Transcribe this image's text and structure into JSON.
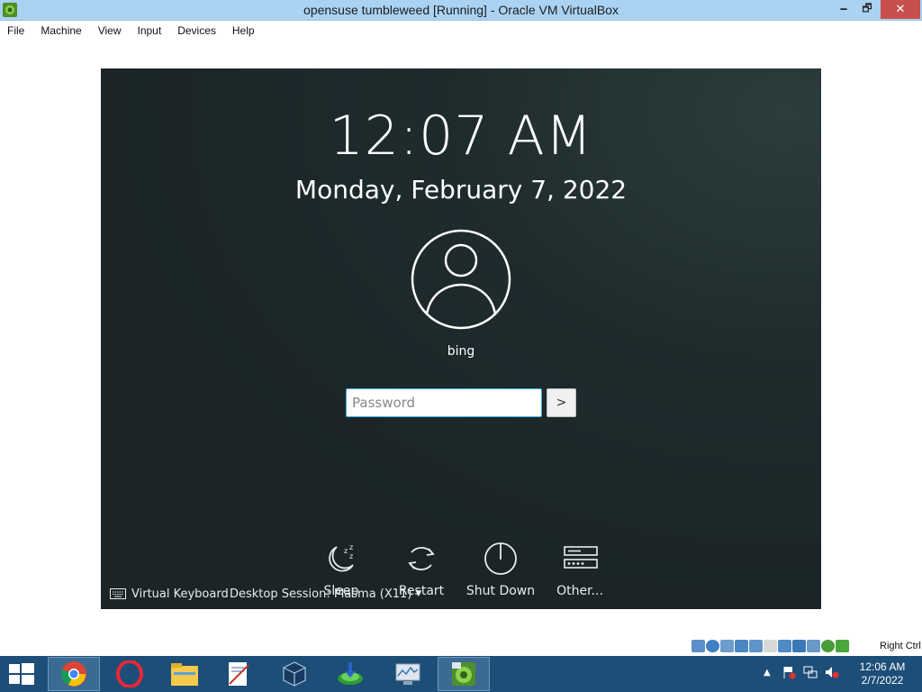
{
  "window": {
    "title": "opensuse tumbleweed [Running] - Oracle VM VirtualBox",
    "minimize_glyph": "🗕",
    "maximize_glyph": "🗗",
    "close_glyph": "✕"
  },
  "menu": [
    "File",
    "Machine",
    "View",
    "Input",
    "Devices",
    "Help"
  ],
  "lockscreen": {
    "time": "12:07 AM",
    "date": "Monday, February 7, 2022",
    "username": "bing",
    "password_placeholder": "Password",
    "submit_glyph": ">",
    "actions": {
      "sleep": "Sleep",
      "restart": "Restart",
      "shutdown": "Shut Down",
      "other": "Other..."
    },
    "virtual_keyboard": "Virtual Keyboard",
    "desktop_session": "Desktop Session: Plasma (X11)"
  },
  "statusbar": {
    "host_key": "Right Ctrl",
    "icons": [
      "hard-disk-icon",
      "optical-drive-icon",
      "audio-icon",
      "network-icon",
      "usb-icon",
      "shared-folders-icon",
      "display-icon",
      "recording-icon",
      "cpu-icon",
      "mouse-integration-icon",
      "keyboard-icon"
    ]
  },
  "taskbar": {
    "pinned": [
      "chrome-icon",
      "opera-icon",
      "file-explorer-icon",
      "document-tool-icon",
      "virtualbox-icon",
      "download-manager-icon",
      "system-monitor-icon",
      "opensuse-vm-icon"
    ],
    "clock_time": "12:06 AM",
    "clock_date": "2/7/2022"
  },
  "colors": {
    "titlebar": "#aad2f2",
    "close": "#c7504e",
    "vm_background": "#1e2b2d",
    "taskbar": "#1c4e78",
    "input_focus": "#3daee9"
  }
}
